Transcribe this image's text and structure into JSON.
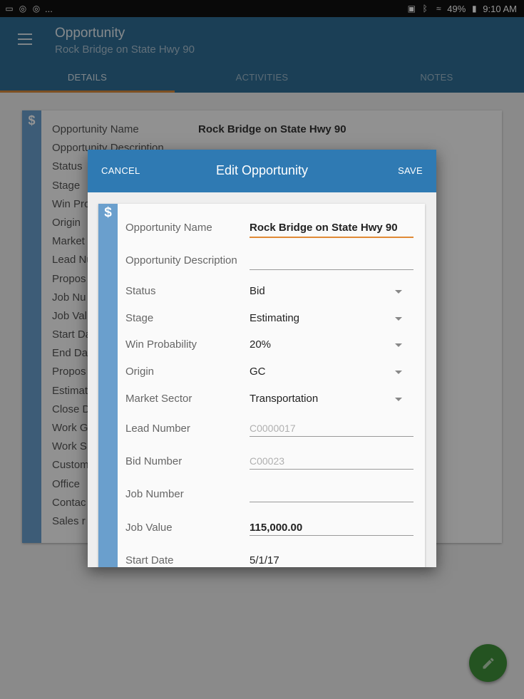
{
  "statusbar": {
    "left_icons": [
      "screen-icon",
      "sync-icon",
      "sync-icon-2"
    ],
    "more": "...",
    "battery": "49%",
    "time": "9:10 AM"
  },
  "app": {
    "title": "Opportunity",
    "subtitle": "Rock Bridge on State Hwy 90"
  },
  "tabs": [
    {
      "label": "DETAILS",
      "active": true
    },
    {
      "label": "ACTIVITIES"
    },
    {
      "label": "NOTES"
    }
  ],
  "card": {
    "icon": "$",
    "rows": [
      "Opportunity Name",
      "Opportunity Description",
      "Status",
      "Stage",
      "Win Pro",
      "Origin",
      "Market",
      "Lead Nu",
      "Propos",
      "Job Nu",
      "Job Val",
      "Start Da",
      "End Da",
      "Propos",
      "Estimat",
      "Close D",
      "Work G",
      "Work S",
      "Custom",
      "Office",
      "Contac",
      "Sales r"
    ],
    "name_value": "Rock Bridge on State Hwy 90"
  },
  "dialog": {
    "cancel": "CANCEL",
    "title": "Edit Opportunity",
    "save": "SAVE",
    "icon": "$",
    "fields": {
      "name": {
        "label": "Opportunity Name",
        "value": "Rock Bridge on State Hwy 90"
      },
      "description": {
        "label": "Opportunity Description",
        "value": ""
      },
      "status": {
        "label": "Status",
        "value": "Bid"
      },
      "stage": {
        "label": "Stage",
        "value": "Estimating"
      },
      "win": {
        "label": "Win Probability",
        "value": "20%"
      },
      "origin": {
        "label": "Origin",
        "value": "GC"
      },
      "sector": {
        "label": "Market Sector",
        "value": "Transportation"
      },
      "lead": {
        "label": "Lead Number",
        "value": "C0000017"
      },
      "bid": {
        "label": "Bid Number",
        "value": "C00023"
      },
      "job_number": {
        "label": "Job Number",
        "value": ""
      },
      "job_value": {
        "label": "Job Value",
        "value": "115,000.00"
      },
      "start": {
        "label": "Start Date",
        "value": "5/1/17"
      }
    }
  },
  "fab": {
    "icon": "pencil-icon"
  }
}
